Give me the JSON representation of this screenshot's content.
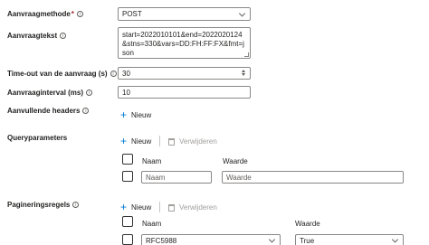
{
  "fields": {
    "method": {
      "label": "Aanvraagmethode",
      "required_mark": "*",
      "value": "POST"
    },
    "body": {
      "label": "Aanvraagtekst",
      "value": "start=2022010101&end=2022020124&stns=330&vars=DD:FH:FF:FX&fmt=json"
    },
    "timeout": {
      "label": "Time-out van de aanvraag (s)",
      "value": "30"
    },
    "interval": {
      "label": "Aanvraaginterval (ms)",
      "value": "10"
    },
    "headers": {
      "label": "Aanvullende headers",
      "new_label": "Nieuw"
    }
  },
  "query": {
    "label": "Queryparameters",
    "new_label": "Nieuw",
    "delete_label": "Verwijderen",
    "col_name": "Naam",
    "col_value": "Waarde",
    "row_name_placeholder": "Naam",
    "row_value_placeholder": "Waarde"
  },
  "paging": {
    "label": "Pagineringsregels",
    "new_label": "Nieuw",
    "delete_label": "Verwijderen",
    "col_name": "Naam",
    "col_value": "Waarde",
    "row_name": "RFC5988",
    "row_value": "True"
  },
  "icons": {
    "info": "info-icon",
    "dropdown": "chevron-down-icon",
    "add": "plus-icon",
    "delete": "trash-icon",
    "spinner": "spinner-icon"
  },
  "colors": {
    "accent": "#0078d4",
    "required": "#a4262c",
    "border": "#8a8886"
  }
}
